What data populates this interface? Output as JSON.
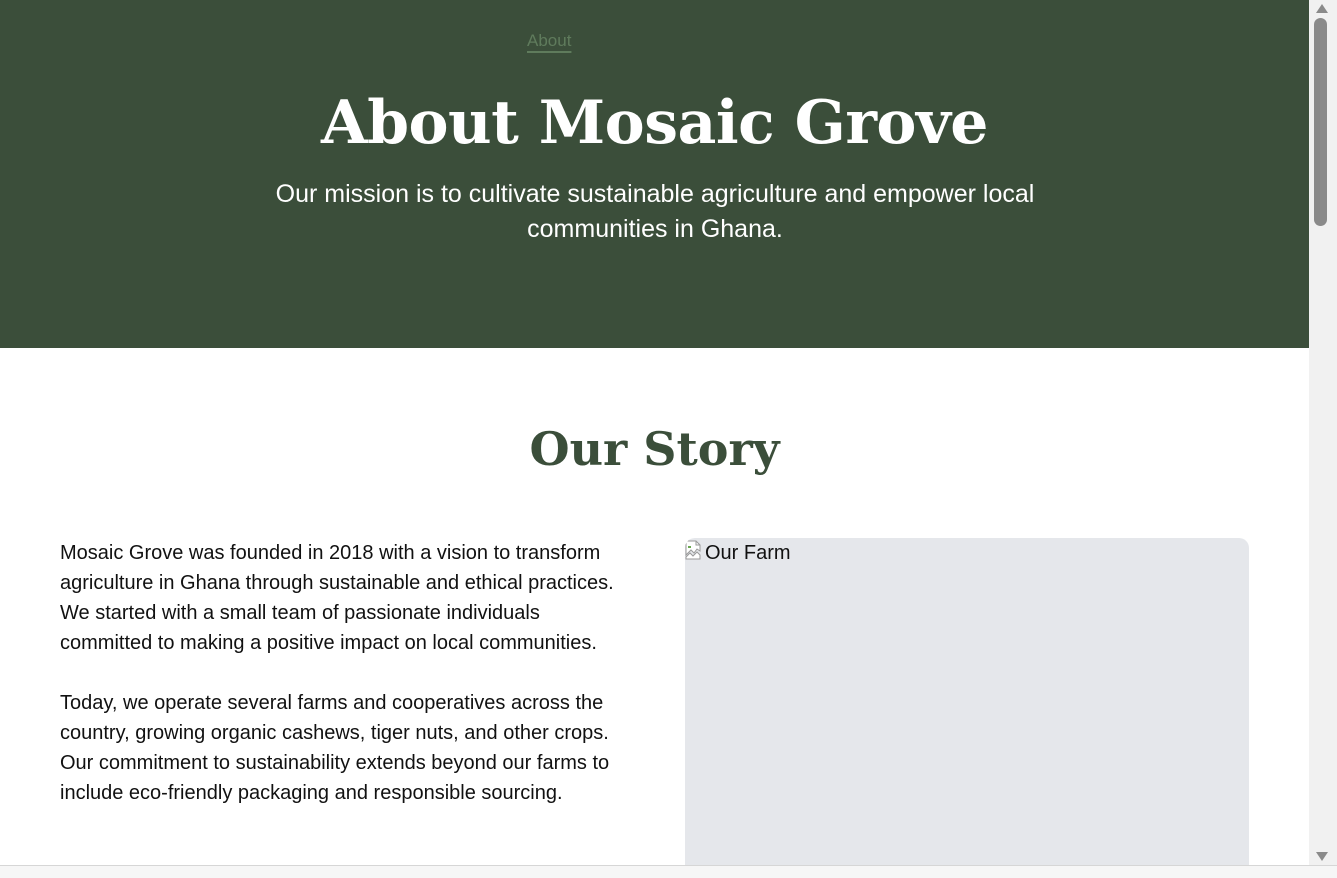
{
  "hero": {
    "nav_link": "About",
    "title": "About Mosaic Grove",
    "subtitle": "Our mission is to cultivate sustainable agriculture and empower local communities in Ghana."
  },
  "story": {
    "heading": "Our Story",
    "paragraphs": [
      "Mosaic Grove was founded in 2018 with a vision to transform agriculture in Ghana through sustainable and ethical practices. We started with a small team of passionate individuals committed to making a positive impact on local communities.",
      "Today, we operate several farms and cooperatives across the country, growing organic cashews, tiger nuts, and other crops. Our commitment to sustainability extends beyond our farms to include eco-friendly packaging and responsible sourcing."
    ],
    "image_alt": "Our Farm",
    "image_icon": "broken-image-icon"
  },
  "colors": {
    "hero_bg": "#3b4e3a",
    "heading": "#3b4e3a",
    "image_placeholder": "#e5e7eb"
  }
}
